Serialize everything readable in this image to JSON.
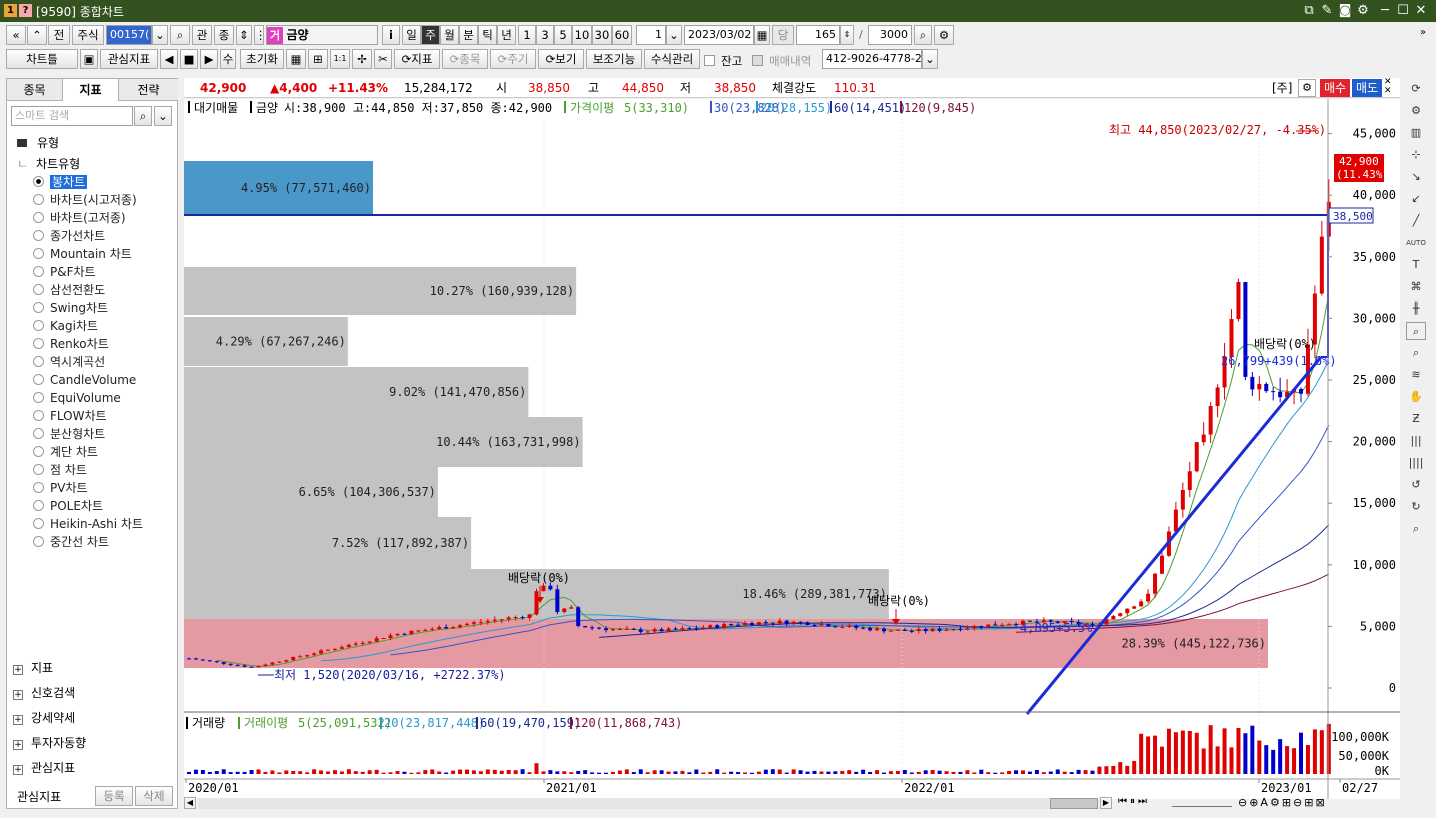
{
  "window": {
    "title": "[9590] 종합차트",
    "badge1": "1",
    "badge2": "?"
  },
  "toolbar1": {
    "market": "주식",
    "code": "001570",
    "code_shown": "00157(",
    "cat1": "관",
    "cat2": "종",
    "badge": "거",
    "name": "금양",
    "periods": [
      "일",
      "주",
      "월",
      "분",
      "틱",
      "년"
    ],
    "active_period": "주",
    "minutes": [
      "1",
      "3",
      "5",
      "10",
      "30",
      "60"
    ],
    "unit_value": "1",
    "date": "2023/03/02",
    "count_label": "당",
    "count": "165",
    "slash": "/",
    "max": "3000",
    "info": "i",
    "prev": "전"
  },
  "toolbar2": {
    "chart_type": "차트틀",
    "watch": "관심지표",
    "num_label": "수",
    "reset": "초기화",
    "indicator": "지표",
    "stock": "종목",
    "cycle": "주기",
    "view": "보기",
    "aux": "보조기능",
    "formula": "수식관리",
    "balance": "잔고",
    "trade_history": "매매내역",
    "account": "412-9026-4778-2"
  },
  "left_panel": {
    "tabs": [
      "종목",
      "지표",
      "전략"
    ],
    "active_tab": "지표",
    "search_placeholder": "스마트 검색",
    "folder": "유형",
    "subfolder": "차트유형",
    "chart_types": [
      "봉차트",
      "바차트(시고저종)",
      "바차트(고저종)",
      "종가선차트",
      "Mountain 차트",
      "P&F차트",
      "삼선전환도",
      "Swing차트",
      "Kagi차트",
      "Renko차트",
      "역시계곡선",
      "CandleVolume",
      "EquiVolume",
      "FLOW차트",
      "분산형차트",
      "계단 차트",
      "점 차트",
      "PV차트",
      "POLE차트",
      "Heikin-Ashi 차트",
      "중간선 차트"
    ],
    "selected": "봉차트",
    "sections": [
      "지표",
      "신호검색",
      "강세약세",
      "투자자동향",
      "관심지표"
    ],
    "footer_label": "관심지표",
    "register": "등록",
    "delete": "삭제"
  },
  "price_bar": {
    "price": "42,900",
    "change": "▲4,400",
    "change_pct": "+11.43%",
    "volume": "15,284,172",
    "open_label": "시",
    "open": "38,850",
    "high_label": "고",
    "high": "44,850",
    "low_label": "저",
    "low": "38,850",
    "strength_label": "체결강도",
    "strength": "110.31",
    "note": "[주]",
    "buy": "매수",
    "sell": "매도"
  },
  "legend": {
    "vp": "대기매물",
    "stock": "금양",
    "ohlc": "시:38,900 고:44,850 저:37,850 종:42,900",
    "ma_label": "가격이평",
    "ma5": "5(33,310)",
    "ma30": "30(23,828)",
    "ma20": "20(28,155)",
    "ma60": "60(14,451)",
    "ma120": "120(9,845)"
  },
  "volume_legend": {
    "label": "거래량",
    "ma_label": "거래이평",
    "ma5": "5(25,091,532)",
    "ma20": "20(23,817,448)",
    "ma60": "60(19,470,159)",
    "ma120": "120(11,868,743)"
  },
  "annotations": {
    "high": "최고 44,850(2023/02/27, -4.35%)",
    "low": "최저 1,520(2020/03/16, +2722.37%)",
    "div1": "배당락(0%)",
    "div2": "배당락(0%)",
    "div3": "배당락(0%)",
    "trend": "26,799+439(1.6%)",
    "trend2": "4,895+5.5%",
    "current_price": "42,900",
    "current_pct": "(11.43%)",
    "hline": "38,500"
  },
  "y_axis": [
    "45,000",
    "40,000",
    "35,000",
    "30,000",
    "25,000",
    "20,000",
    "15,000",
    "10,000",
    "5,000",
    "0"
  ],
  "vol_axis": [
    "100,000K",
    "50,000K",
    "0K"
  ],
  "x_axis": [
    "2020/01",
    "2021/01",
    "2022/01",
    "2023/01",
    "02/27"
  ],
  "volume_profile": [
    {
      "label": "4.95% (77,571,460)",
      "pct": 4.95
    },
    {
      "label": "10.27% (160,939,128)",
      "pct": 10.27
    },
    {
      "label": "4.29% (67,267,246)",
      "pct": 4.29
    },
    {
      "label": "9.02% (141,470,856)",
      "pct": 9.02
    },
    {
      "label": "10.44% (163,731,998)",
      "pct": 10.44
    },
    {
      "label": "6.65% (104,306,537)",
      "pct": 6.65
    },
    {
      "label": "7.52% (117,892,387)",
      "pct": 7.52
    },
    {
      "label": "18.46% (289,381,773)",
      "pct": 18.46
    },
    {
      "label": "28.39% (445,122,736)",
      "pct": 28.39
    }
  ],
  "colors": {
    "up": "#e00000",
    "down": "#0000cc",
    "vp_gray": "#c3c3c3",
    "vp_blue": "#4a98c9",
    "vp_pink": "#e59aa3",
    "title_bg": "#33521f"
  }
}
